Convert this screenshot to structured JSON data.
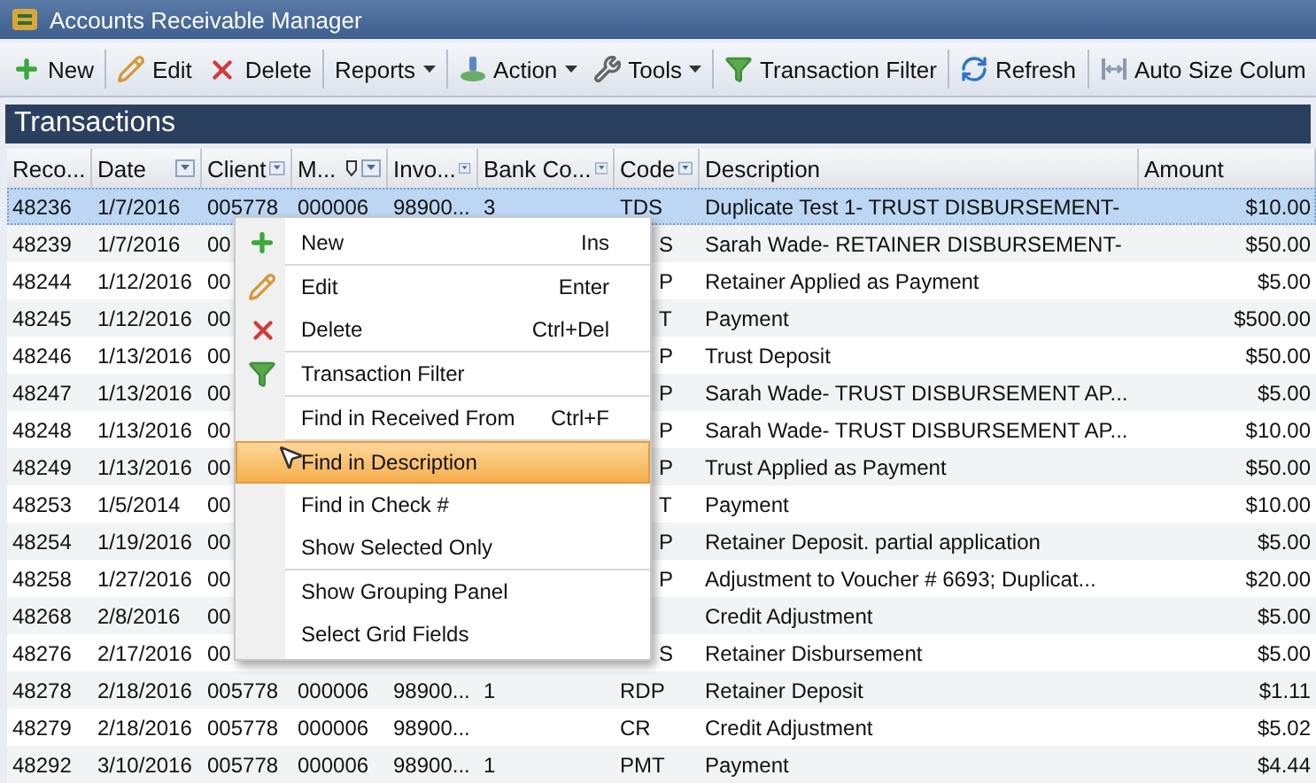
{
  "window": {
    "title": "Accounts Receivable Manager"
  },
  "toolbar": [
    {
      "kind": "icon",
      "label": "New"
    },
    {
      "kind": "sep"
    },
    {
      "kind": "icon",
      "label": "Edit"
    },
    {
      "kind": "icon",
      "label": "Delete"
    },
    {
      "kind": "sep"
    },
    {
      "kind": "dropdown",
      "label": "Reports"
    },
    {
      "kind": "sep"
    },
    {
      "kind": "dropdown",
      "label": "Action"
    },
    {
      "kind": "dropdown",
      "label": "Tools"
    },
    {
      "kind": "sep"
    },
    {
      "kind": "icon",
      "label": "Transaction Filter"
    },
    {
      "kind": "sep"
    },
    {
      "kind": "icon",
      "label": "Refresh"
    },
    {
      "kind": "sep"
    },
    {
      "kind": "icon",
      "label": "Auto Size Colum"
    }
  ],
  "panel": {
    "title": "Transactions"
  },
  "columns": [
    {
      "label": "Reco...",
      "filter": false
    },
    {
      "label": "Date",
      "filter": true
    },
    {
      "label": "Client",
      "filter": true
    },
    {
      "label": "M...",
      "filter": true,
      "pin": true
    },
    {
      "label": "Invo...",
      "filter": true
    },
    {
      "label": "Bank Co...",
      "filter": true
    },
    {
      "label": "Code",
      "filter": true
    },
    {
      "label": "Description",
      "filter": false
    },
    {
      "label": "Amount",
      "filter": false
    }
  ],
  "rows": [
    {
      "selected": true,
      "cells": [
        "48236",
        "1/7/2016",
        "005778",
        "000006",
        "98900...",
        "3",
        "TDS",
        "Duplicate Test 1- TRUST DISBURSEMENT-",
        "$10.00"
      ]
    },
    {
      "selected": false,
      "cells": [
        "48239",
        "1/7/2016",
        "00",
        "",
        "",
        "",
        "S",
        "Sarah Wade- RETAINER DISBURSEMENT-",
        "$50.00"
      ]
    },
    {
      "selected": false,
      "cells": [
        "48244",
        "1/12/2016",
        "00",
        "",
        "",
        "",
        "P",
        "Retainer Applied as Payment",
        "$5.00"
      ]
    },
    {
      "selected": false,
      "cells": [
        "48245",
        "1/12/2016",
        "00",
        "",
        "",
        "",
        "T",
        "Payment",
        "$500.00"
      ]
    },
    {
      "selected": false,
      "cells": [
        "48246",
        "1/13/2016",
        "00",
        "",
        "",
        "",
        "P",
        "Trust Deposit",
        "$50.00"
      ]
    },
    {
      "selected": false,
      "cells": [
        "48247",
        "1/13/2016",
        "00",
        "",
        "",
        "",
        "P",
        "Sarah Wade- TRUST DISBURSEMENT AP...",
        "$5.00"
      ]
    },
    {
      "selected": false,
      "cells": [
        "48248",
        "1/13/2016",
        "00",
        "",
        "",
        "",
        "P",
        "Sarah Wade- TRUST DISBURSEMENT AP...",
        "$10.00"
      ]
    },
    {
      "selected": false,
      "cells": [
        "48249",
        "1/13/2016",
        "00",
        "",
        "",
        "",
        "P",
        "Trust Applied as Payment",
        "$50.00"
      ]
    },
    {
      "selected": false,
      "cells": [
        "48253",
        "1/5/2014",
        "00",
        "",
        "",
        "",
        "T",
        "Payment",
        "$10.00"
      ]
    },
    {
      "selected": false,
      "cells": [
        "48254",
        "1/19/2016",
        "00",
        "",
        "",
        "",
        "P",
        "Retainer Deposit. partial application",
        "$5.00"
      ]
    },
    {
      "selected": false,
      "cells": [
        "48258",
        "1/27/2016",
        "00",
        "",
        "",
        "",
        "P",
        "Adjustment to Voucher # 6693; Duplicat...",
        "$20.00"
      ]
    },
    {
      "selected": false,
      "cells": [
        "48268",
        "2/8/2016",
        "00",
        "",
        "",
        "",
        "",
        "Credit Adjustment",
        "$5.00"
      ]
    },
    {
      "selected": false,
      "cells": [
        "48276",
        "2/17/2016",
        "00",
        "",
        "",
        "",
        "S",
        "Retainer Disbursement",
        "$5.00"
      ]
    },
    {
      "selected": false,
      "cells": [
        "48278",
        "2/18/2016",
        "005778",
        "000006",
        "98900...",
        "1",
        "RDP",
        "Retainer Deposit",
        "$1.11"
      ]
    },
    {
      "selected": false,
      "cells": [
        "48279",
        "2/18/2016",
        "005778",
        "000006",
        "98900...",
        "",
        "CR",
        "Credit Adjustment",
        "$5.02"
      ]
    },
    {
      "selected": false,
      "cells": [
        "48292",
        "3/10/2016",
        "005778",
        "000006",
        "98900...",
        "1",
        "PMT",
        "Payment",
        "$4.44"
      ]
    }
  ],
  "context_menu": {
    "groups": [
      [
        {
          "label": "New",
          "shortcut": "Ins",
          "selected": false
        }
      ],
      [
        {
          "label": "Edit",
          "shortcut": "Enter",
          "selected": false
        },
        {
          "label": "Delete",
          "shortcut": "Ctrl+Del",
          "selected": false
        }
      ],
      [
        {
          "label": "Transaction Filter",
          "selected": false
        }
      ],
      [
        {
          "label": "Find in Received From",
          "shortcut": "Ctrl+F",
          "selected": false
        }
      ],
      [
        {
          "label": "Find in Description",
          "selected": true
        },
        {
          "label": "Find in Check #",
          "selected": false
        },
        {
          "label": "Show Selected Only",
          "selected": false
        }
      ],
      [
        {
          "label": "Show Grouping Panel",
          "selected": false
        },
        {
          "label": "Select Grid Fields",
          "selected": false
        }
      ]
    ]
  }
}
